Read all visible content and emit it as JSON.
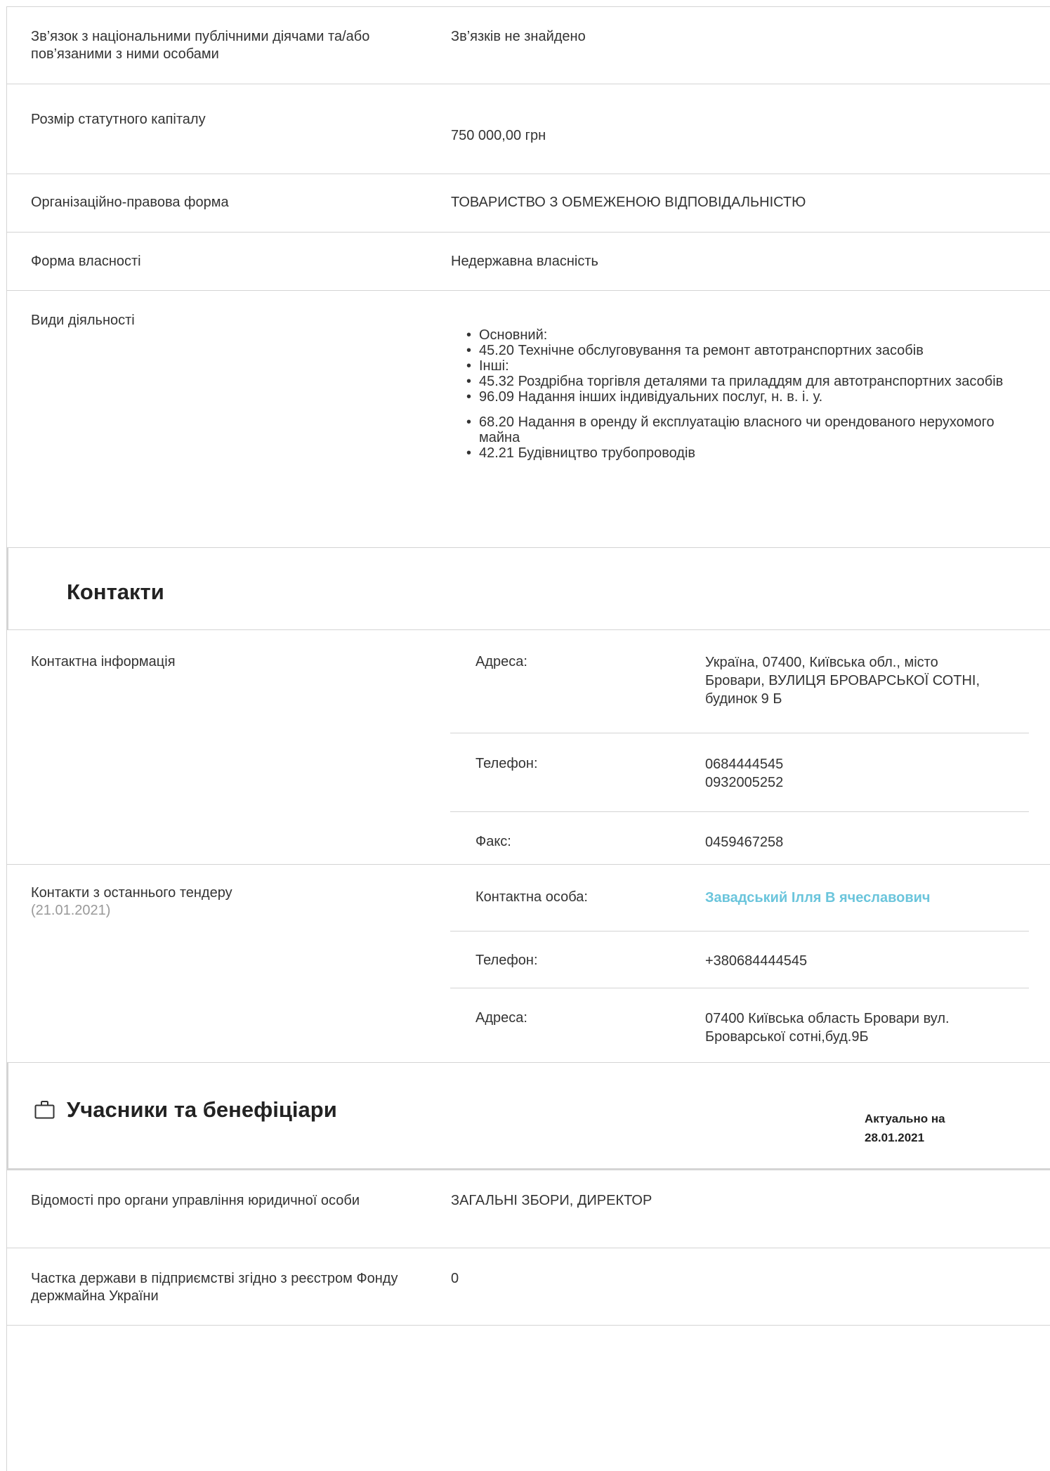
{
  "rows": {
    "pep": {
      "label": "Зв’язок з національними публічними діячами та/або пов’язаними з ними особами",
      "value": "Зв’язків не знайдено"
    },
    "capital": {
      "label": "Розмір статутного капіталу",
      "value": "750 000,00 грн"
    },
    "legal_form": {
      "label": "Організаційно-правова форма",
      "value": "ТОВАРИСТВО З ОБМЕЖЕНОЮ ВІДПОВІДАЛЬНІСТЮ"
    },
    "ownership": {
      "label": "Форма власності",
      "value": "Недержавна власність"
    },
    "activities": {
      "label": "Види діяльності",
      "items": [
        "Основний:",
        "45.20 Технічне обслуговування та ремонт автотранспортних засобів",
        "Інші:",
        "45.32 Роздрібна торгівля деталями та приладдям для автотранспортних засобів",
        "96.09 Надання інших індивідуальних послуг, н. в. і. у.",
        "68.20 Надання в оренду й експлуатацію власного чи орендованого нерухомого майна",
        "42.21 Будівництво трубопроводів"
      ]
    }
  },
  "contacts": {
    "title": "Контакти",
    "info_label": "Контактна інформація",
    "address_key": "Адреса:",
    "address_value": "Україна, 07400, Київська обл., місто Бровари, ВУЛИЦЯ БРОВАРСЬКОЇ СОТНІ, будинок 9 Б",
    "phone_key": "Телефон:",
    "phone_1": "0684444545",
    "phone_2": "0932005252",
    "fax_key": "Факс:",
    "fax_value": "0459467258",
    "tender_label": "Контакти з останнього тендеру",
    "tender_date": "(21.01.2021)",
    "person_key": "Контактна особа:",
    "person_value": "Завадський Ілля В ячеславович",
    "tender_phone_key": "Телефон:",
    "tender_phone_value": "+380684444545",
    "tender_address_key": "Адреса:",
    "tender_address_value": "07400 Київська область Бровари вул. Броварської сотні,буд.9Б"
  },
  "participants": {
    "title": "Учасники та бенефіціари",
    "actual_label": "Актуально на",
    "actual_date": "28.01.2021",
    "icon": "briefcase-icon",
    "governance_label": "Відомості про органи управління юридичної особи",
    "governance_value": "ЗАГАЛЬНІ ЗБОРИ, ДИРЕКТОР",
    "state_share_label": "Частка держави в підприємстві згідно з реєстром Фонду держмайна України",
    "state_share_value": "0"
  }
}
